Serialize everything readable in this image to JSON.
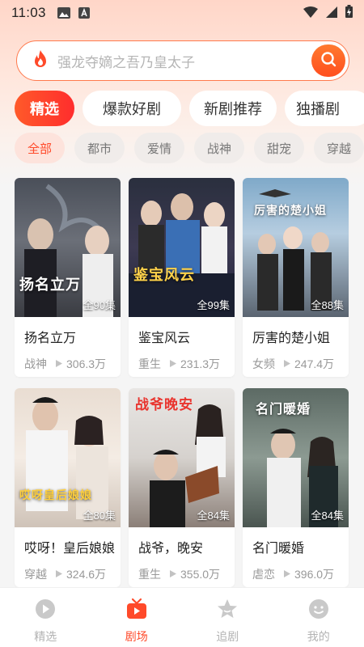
{
  "status_bar": {
    "time": "11:03"
  },
  "search": {
    "placeholder": "强龙夺嫡之吾乃皇太子"
  },
  "tabs": [
    "精选",
    "爆款好剧",
    "新剧推荐",
    "独播剧"
  ],
  "categories": [
    "全部",
    "都市",
    "爱情",
    "战神",
    "甜宠",
    "穿越"
  ],
  "dramas": [
    {
      "title": "扬名立万",
      "episodes": "全90集",
      "tag": "战神",
      "views": "306.3万",
      "poster_text": "扬名立万"
    },
    {
      "title": "鉴宝风云",
      "episodes": "全99集",
      "tag": "重生",
      "views": "231.3万",
      "poster_text": "鉴宝风云"
    },
    {
      "title": "厉害的楚小姐",
      "episodes": "全88集",
      "tag": "女频",
      "views": "247.4万",
      "poster_text": "厉害的楚小姐"
    },
    {
      "title": "哎呀！皇后娘娘",
      "episodes": "全80集",
      "tag": "穿越",
      "views": "324.6万",
      "poster_text": "哎呀皇后娘娘"
    },
    {
      "title": "战爷，晚安",
      "episodes": "全84集",
      "tag": "重生",
      "views": "355.0万",
      "poster_text": "战爷晚安"
    },
    {
      "title": "名门暖婚",
      "episodes": "全84集",
      "tag": "虐恋",
      "views": "396.0万",
      "poster_text": "名门暖婚"
    }
  ],
  "bottom_nav": [
    "精选",
    "剧场",
    "追剧",
    "我的"
  ],
  "colors": {
    "accent": "#ff4a2a",
    "tab_gradient_start": "#ff5a2a",
    "tab_gradient_end": "#ff2d2d"
  }
}
